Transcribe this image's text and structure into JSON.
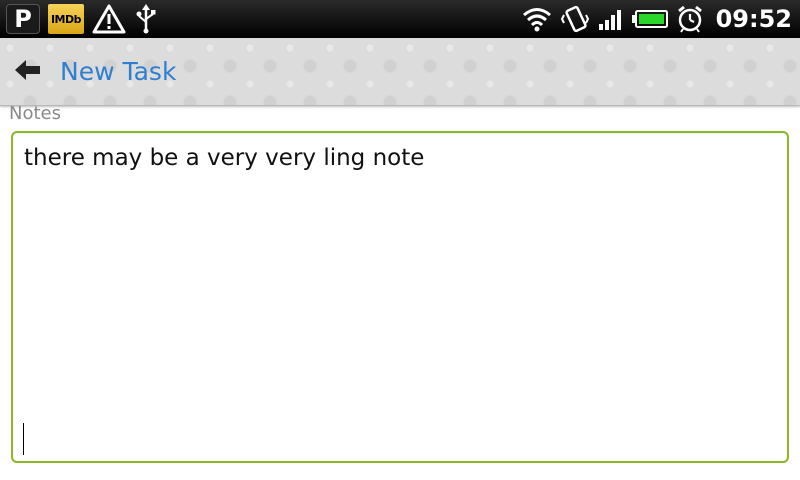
{
  "status_bar": {
    "notifications": [
      {
        "icon": "pandora-icon",
        "text": "P"
      },
      {
        "icon": "imdb-icon",
        "text": "IMDb"
      },
      {
        "icon": "warning-icon"
      },
      {
        "icon": "usb-icon"
      }
    ],
    "system_icons": [
      "wifi-icon",
      "vibrate-icon",
      "signal-icon",
      "battery-icon",
      "alarm-icon"
    ],
    "time": "09:52",
    "colors": {
      "battery": "#2bd62b",
      "status_bg": "#000000"
    }
  },
  "action_bar": {
    "back_icon": "back-arrow-icon",
    "title": "New Task",
    "title_color": "#2f7fd1"
  },
  "notes": {
    "label": "Notes",
    "value": "there may be a very very ling note",
    "border_color": "#8ab829"
  }
}
